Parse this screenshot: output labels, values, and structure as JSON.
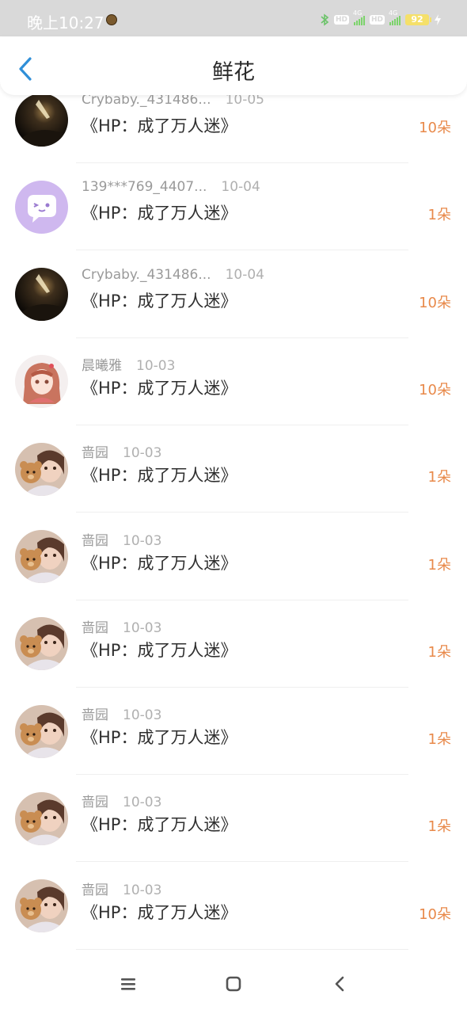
{
  "status_bar": {
    "time": "晚上10:27",
    "battery": "92",
    "network_1": "4G",
    "network_2": "4G",
    "hd_1": "HD",
    "hd_2": "HD"
  },
  "header": {
    "title": "鲜花"
  },
  "records": [
    {
      "name": "Crybaby._431486...",
      "date": "10-05",
      "book": "《HP：成了万人迷》",
      "count": "10朵",
      "avatar": "night-photo"
    },
    {
      "name": "139***769_4407...",
      "date": "10-04",
      "book": "《HP：成了万人迷》",
      "count": "1朵",
      "avatar": "default-cartoon"
    },
    {
      "name": "Crybaby._431486...",
      "date": "10-04",
      "book": "《HP：成了万人迷》",
      "count": "10朵",
      "avatar": "night-photo"
    },
    {
      "name": "晨曦雅",
      "date": "10-03",
      "book": "《HP：成了万人迷》",
      "count": "10朵",
      "avatar": "anime-girl"
    },
    {
      "name": "啬园",
      "date": "10-03",
      "book": "《HP：成了万人迷》",
      "count": "1朵",
      "avatar": "girl-with-teddy"
    },
    {
      "name": "啬园",
      "date": "10-03",
      "book": "《HP：成了万人迷》",
      "count": "1朵",
      "avatar": "girl-with-teddy"
    },
    {
      "name": "啬园",
      "date": "10-03",
      "book": "《HP：成了万人迷》",
      "count": "1朵",
      "avatar": "girl-with-teddy"
    },
    {
      "name": "啬园",
      "date": "10-03",
      "book": "《HP：成了万人迷》",
      "count": "1朵",
      "avatar": "girl-with-teddy"
    },
    {
      "name": "啬园",
      "date": "10-03",
      "book": "《HP：成了万人迷》",
      "count": "1朵",
      "avatar": "girl-with-teddy"
    },
    {
      "name": "啬园",
      "date": "10-03",
      "book": "《HP：成了万人迷》",
      "count": "10朵",
      "avatar": "girl-with-teddy"
    }
  ],
  "icons": {
    "back": "chevron-left-icon",
    "menu": "menu-icon",
    "home": "home-square-icon",
    "nav_back": "nav-back-icon"
  },
  "colors": {
    "accent_blue": "#2f8fd8",
    "count_orange": "#e8894a",
    "status_bar_bg": "#d9d9d9"
  }
}
